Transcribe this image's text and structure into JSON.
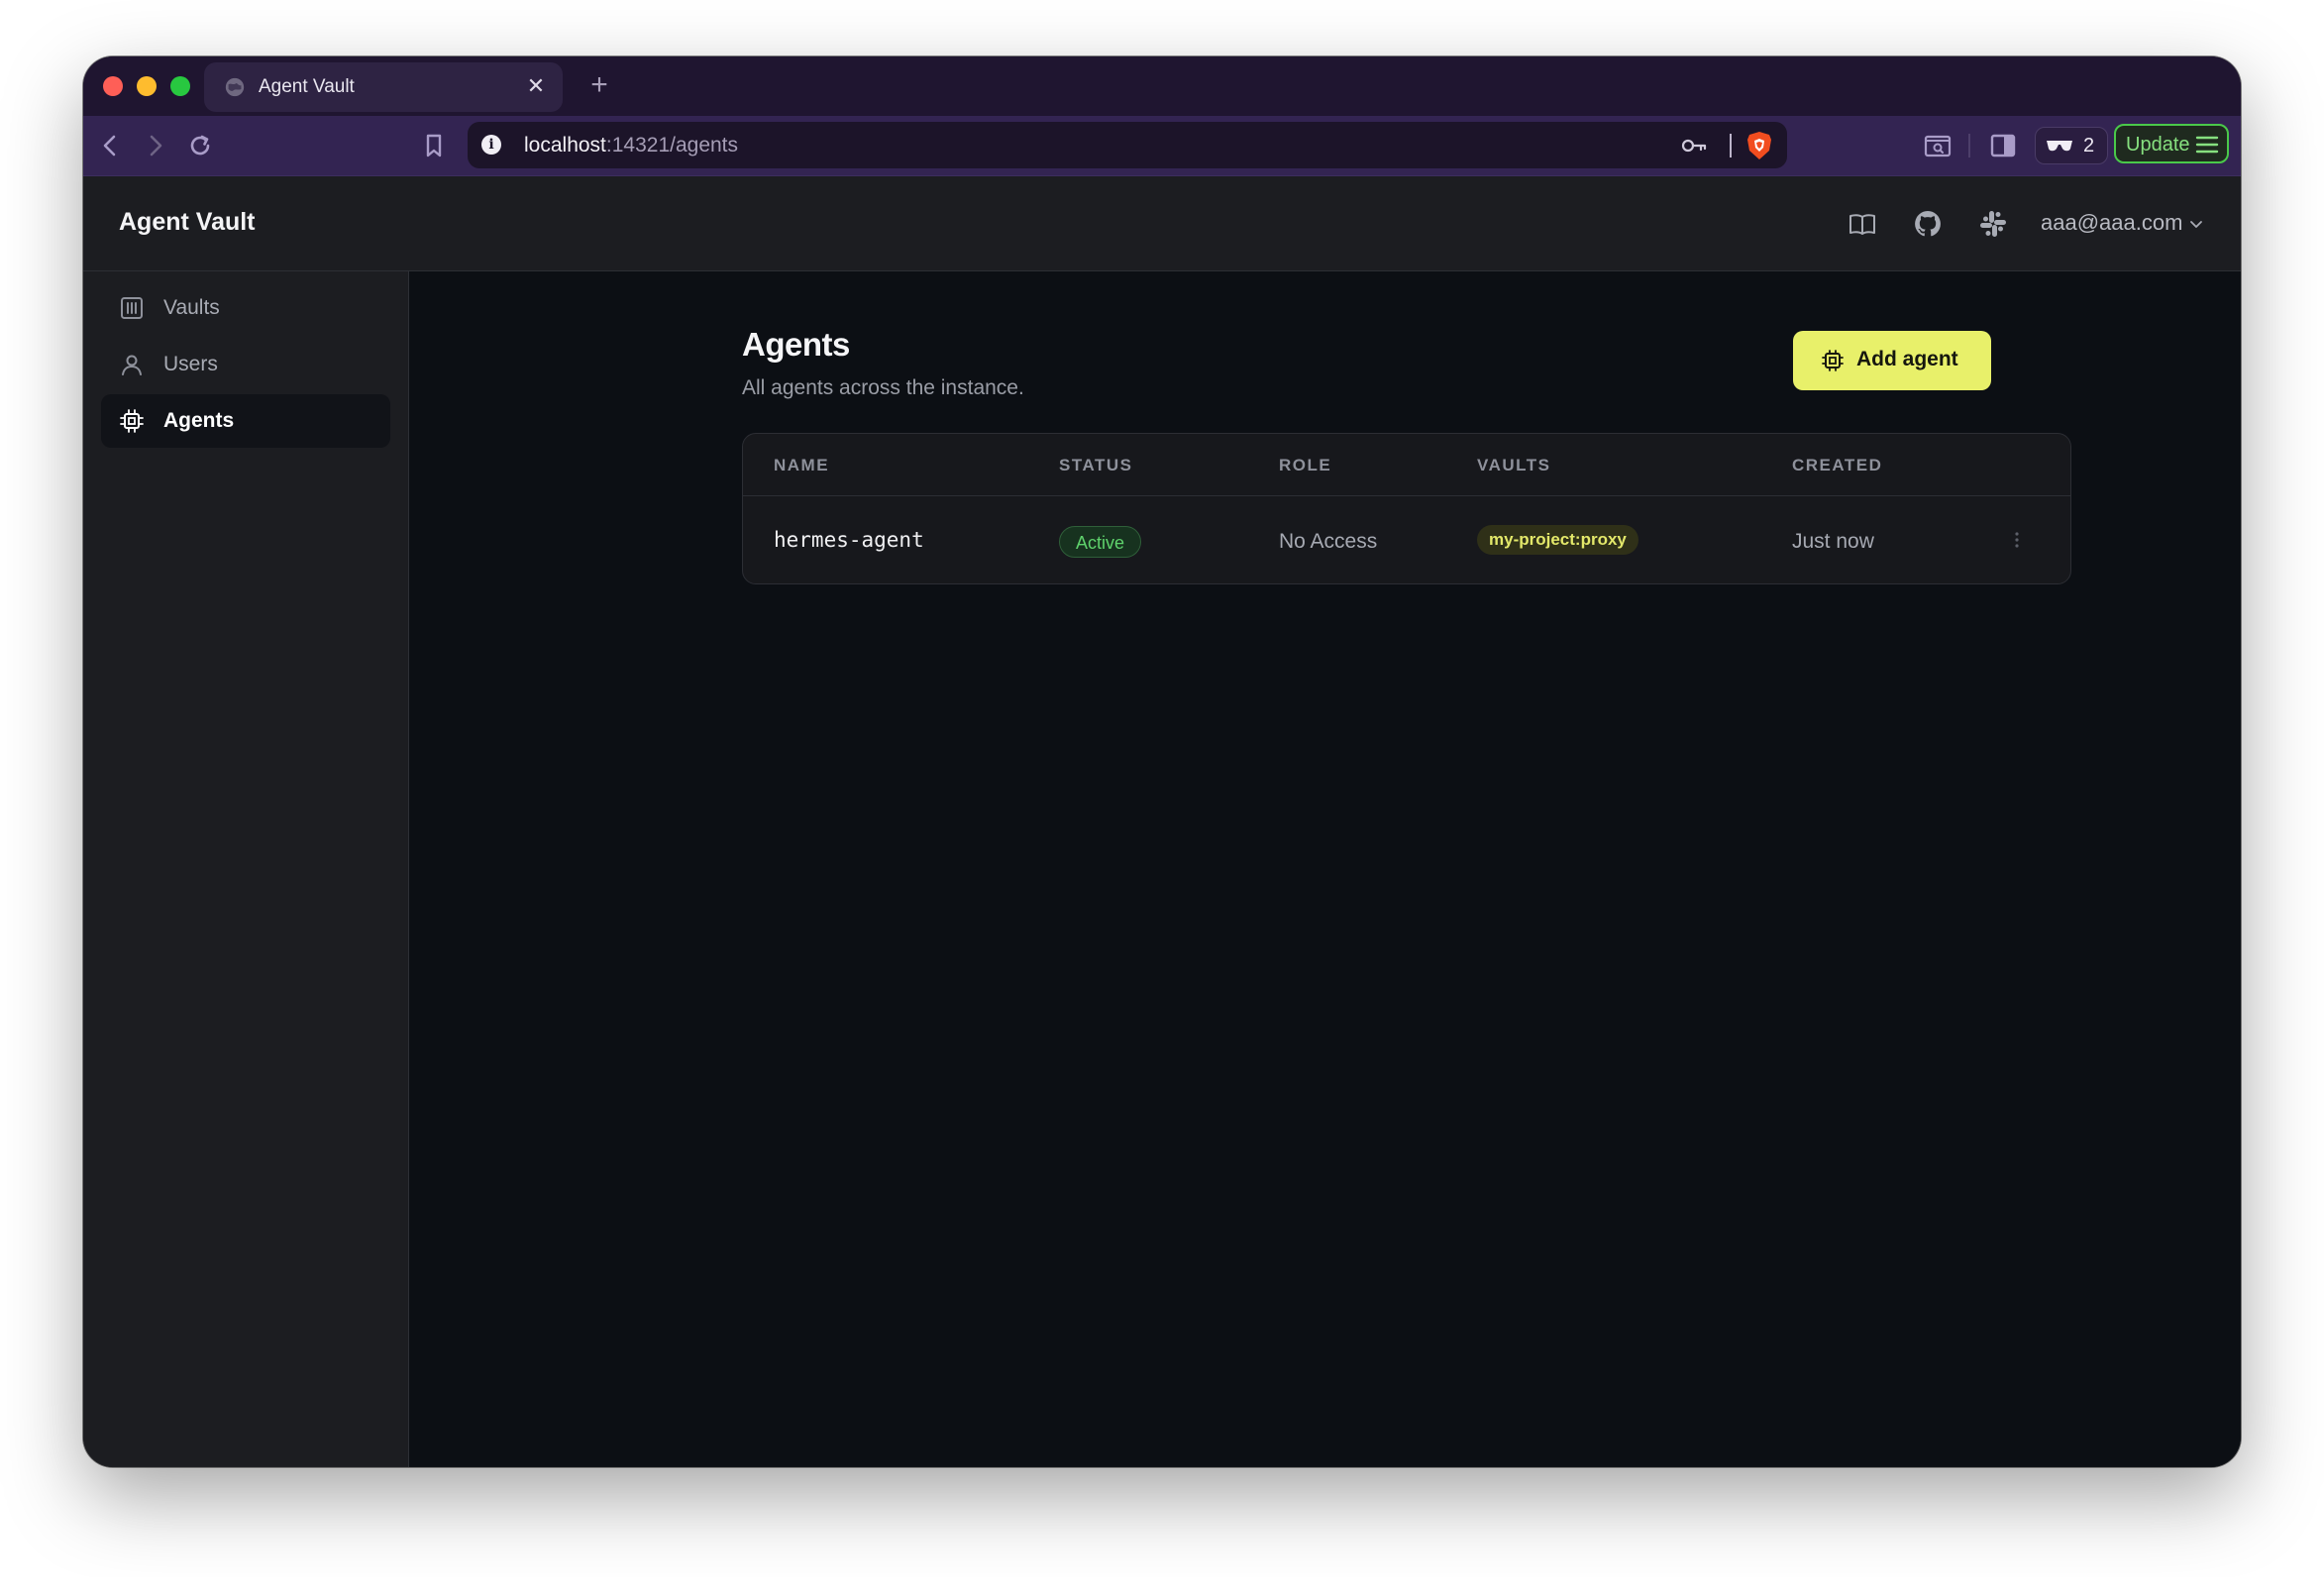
{
  "browser": {
    "tab_title": "Agent Vault",
    "url_host": "localhost",
    "url_path": ":14321/agents",
    "shields_count": "2",
    "update_label": "Update"
  },
  "app": {
    "title": "Agent Vault",
    "user_email": "aaa@aaa.com"
  },
  "sidebar": {
    "items": [
      {
        "label": "Vaults",
        "icon": "vault-icon",
        "active": false
      },
      {
        "label": "Users",
        "icon": "user-icon",
        "active": false
      },
      {
        "label": "Agents",
        "icon": "cpu-icon",
        "active": true
      }
    ]
  },
  "page": {
    "title": "Agents",
    "subtitle": "All agents across the instance.",
    "add_button": "Add agent"
  },
  "table": {
    "columns": [
      "NAME",
      "STATUS",
      "ROLE",
      "VAULTS",
      "CREATED"
    ],
    "rows": [
      {
        "name": "hermes-agent",
        "status": "Active",
        "role": "No Access",
        "vaults": "my-project:proxy",
        "created": "Just now"
      }
    ]
  },
  "colors": {
    "accent": "#e8f06a",
    "status_active": "#5fd26c",
    "background": "#0c0f14",
    "chrome": "#332452"
  }
}
